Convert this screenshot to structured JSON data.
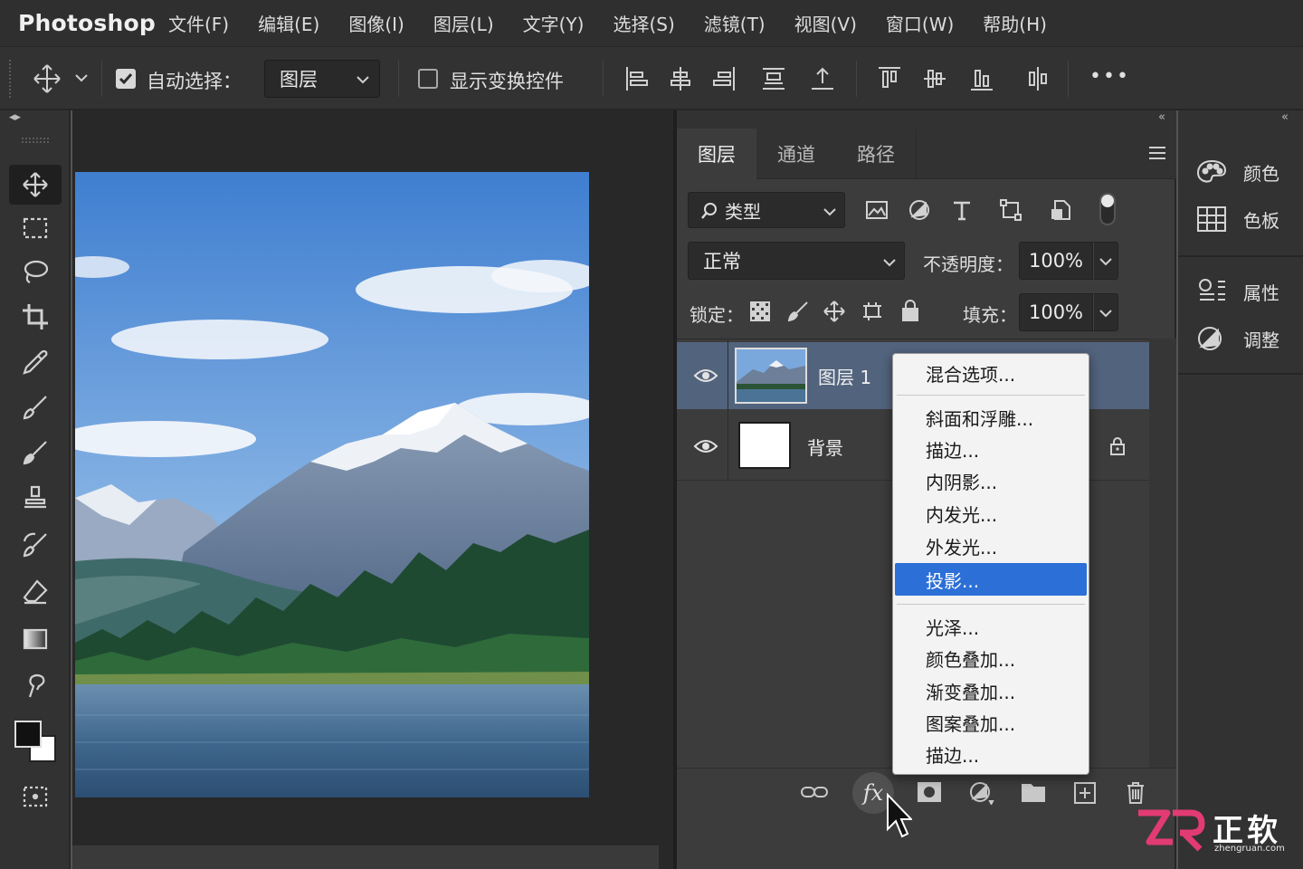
{
  "app": {
    "title": "Photoshop"
  },
  "menu": [
    "文件(F)",
    "编辑(E)",
    "图像(I)",
    "图层(L)",
    "文字(Y)",
    "选择(S)",
    "滤镜(T)",
    "视图(V)",
    "窗口(W)",
    "帮助(H)"
  ],
  "options": {
    "auto_select_label": "自动选择：",
    "auto_select_checked": true,
    "auto_select_target": "图层",
    "show_transform_label": "显示变换控件",
    "show_transform_checked": false,
    "more_label": "•••"
  },
  "layers_panel": {
    "tabs": [
      "图层",
      "通道",
      "路径"
    ],
    "active_tab": "图层",
    "filter_label": "类型",
    "blend_mode": "正常",
    "opacity_label": "不透明度：",
    "opacity_value": "100%",
    "lock_label": "锁定：",
    "fill_label": "填充：",
    "fill_value": "100%",
    "layers": [
      {
        "name": "图层 1",
        "selected": true,
        "visible": true,
        "locked": false
      },
      {
        "name": "背景",
        "selected": false,
        "visible": true,
        "locked": true
      }
    ],
    "footer_fx_label": "fx"
  },
  "context_menu": {
    "items": [
      "混合选项...",
      "斜面和浮雕...",
      "描边...",
      "内阴影...",
      "内发光...",
      "外发光...",
      "投影...",
      "光泽...",
      "颜色叠加...",
      "渐变叠加...",
      "图案叠加...",
      "描边..."
    ],
    "highlighted": "投影..."
  },
  "dock": {
    "items": [
      "颜色",
      "色板",
      "属性",
      "调整"
    ]
  },
  "watermark": {
    "brand": "正软",
    "url": "zhengruan.com"
  },
  "colors": {
    "highlight": "#2c6fd6",
    "selected_layer": "#52637d",
    "panel_bg": "#3c3c3c",
    "chrome_bg": "#323232"
  }
}
